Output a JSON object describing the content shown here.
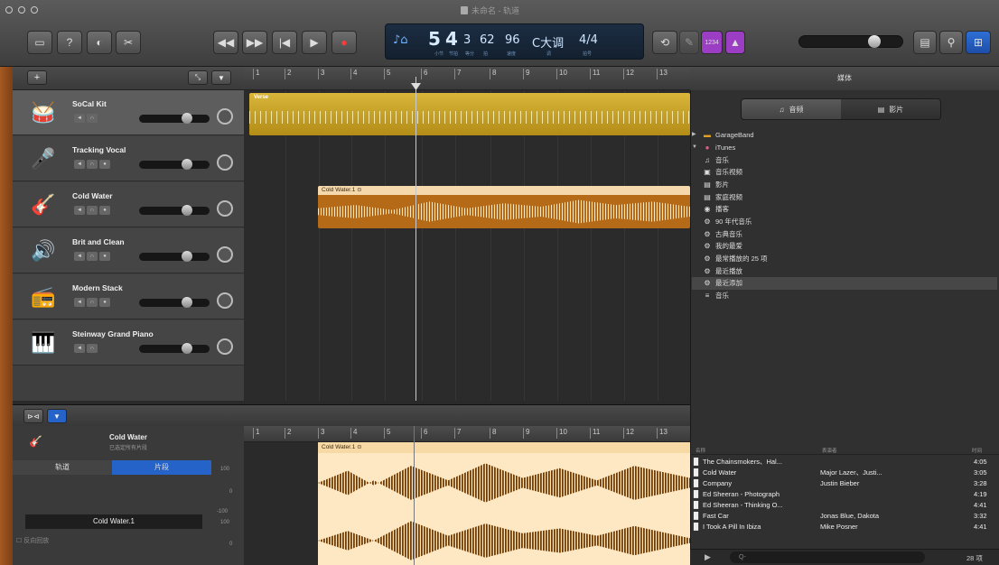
{
  "window": {
    "title": "未命名 - 轨道"
  },
  "toolbar": {
    "lcd": {
      "bar": "5",
      "beat": "4",
      "div": "3",
      "tick": "62",
      "tempo": "96",
      "key": "C大调",
      "signature": "4/4",
      "captions": [
        "小节",
        "节拍",
        "等分",
        "拍",
        "速度",
        "调",
        "拍号"
      ]
    },
    "count_in": "1234"
  },
  "ruler": {
    "bars": [
      "1",
      "2",
      "3",
      "4",
      "5",
      "6",
      "7",
      "8",
      "9",
      "10",
      "11",
      "12",
      "13"
    ]
  },
  "tracks": [
    {
      "name": "SoCal Kit",
      "icon": "🥁"
    },
    {
      "name": "Tracking Vocal",
      "icon": "🎤"
    },
    {
      "name": "Cold Water",
      "icon": "🎸"
    },
    {
      "name": "Brit and Clean",
      "icon": "🔊"
    },
    {
      "name": "Modern Stack",
      "icon": "📻"
    },
    {
      "name": "Steinway Grand Piano",
      "icon": "🎹"
    }
  ],
  "regions": {
    "verse": "Verse",
    "cold_water": "Cold Water.1"
  },
  "library": {
    "title": "媒体",
    "tabs": [
      "音频",
      "影片"
    ],
    "tree": [
      {
        "label": "GarageBand",
        "level": 0,
        "icon": "▶"
      },
      {
        "label": "iTunes",
        "level": 0,
        "icon": "▼"
      },
      {
        "label": "音乐",
        "level": 1,
        "icon": "♫"
      },
      {
        "label": "音乐视频",
        "level": 1,
        "icon": "▣"
      },
      {
        "label": "影片",
        "level": 1,
        "icon": "▤"
      },
      {
        "label": "家庭视频",
        "level": 1,
        "icon": "▤"
      },
      {
        "label": "播客",
        "level": 1,
        "icon": "◉"
      },
      {
        "label": "90 年代音乐",
        "level": 1,
        "icon": "⚙"
      },
      {
        "label": "古典音乐",
        "level": 1,
        "icon": "⚙"
      },
      {
        "label": "我的最爱",
        "level": 1,
        "icon": "⚙"
      },
      {
        "label": "最常播放的 25 项",
        "level": 1,
        "icon": "⚙"
      },
      {
        "label": "最近播放",
        "level": 1,
        "icon": "⚙"
      },
      {
        "label": "最近添加",
        "level": 1,
        "icon": "⚙"
      },
      {
        "label": "音乐",
        "level": 1,
        "icon": "≡"
      }
    ],
    "columns": [
      "名称",
      "表演者",
      "时间"
    ],
    "songs": [
      {
        "name": "The Chainsmokers、Hal...",
        "artist": "",
        "time": "4:05"
      },
      {
        "name": "Cold Water",
        "artist": "Major Lazer、Justi...",
        "time": "3:05"
      },
      {
        "name": "Company",
        "artist": "Justin Bieber",
        "time": "3:28"
      },
      {
        "name": "Ed Sheeran - Photograph",
        "artist": "",
        "time": "4:19"
      },
      {
        "name": "Ed Sheeran - Thinking O...",
        "artist": "",
        "time": "4:41"
      },
      {
        "name": "Fast Car",
        "artist": "Jonas Blue, Dakota",
        "time": "3:32"
      },
      {
        "name": "I Took A Pill In Ibiza",
        "artist": "Mike Posner",
        "time": "4:41"
      }
    ],
    "count": "28 项",
    "search_placeholder": "Q-"
  },
  "editor": {
    "track_name": "Cold Water",
    "subtitle": "已选定所有片段",
    "tabs": [
      "轨道",
      "片段"
    ],
    "region_name": "Cold Water.1",
    "checkbox": "反向回放",
    "db_labels": [
      "100",
      "0",
      "-100",
      "100",
      "0",
      "-100"
    ]
  }
}
